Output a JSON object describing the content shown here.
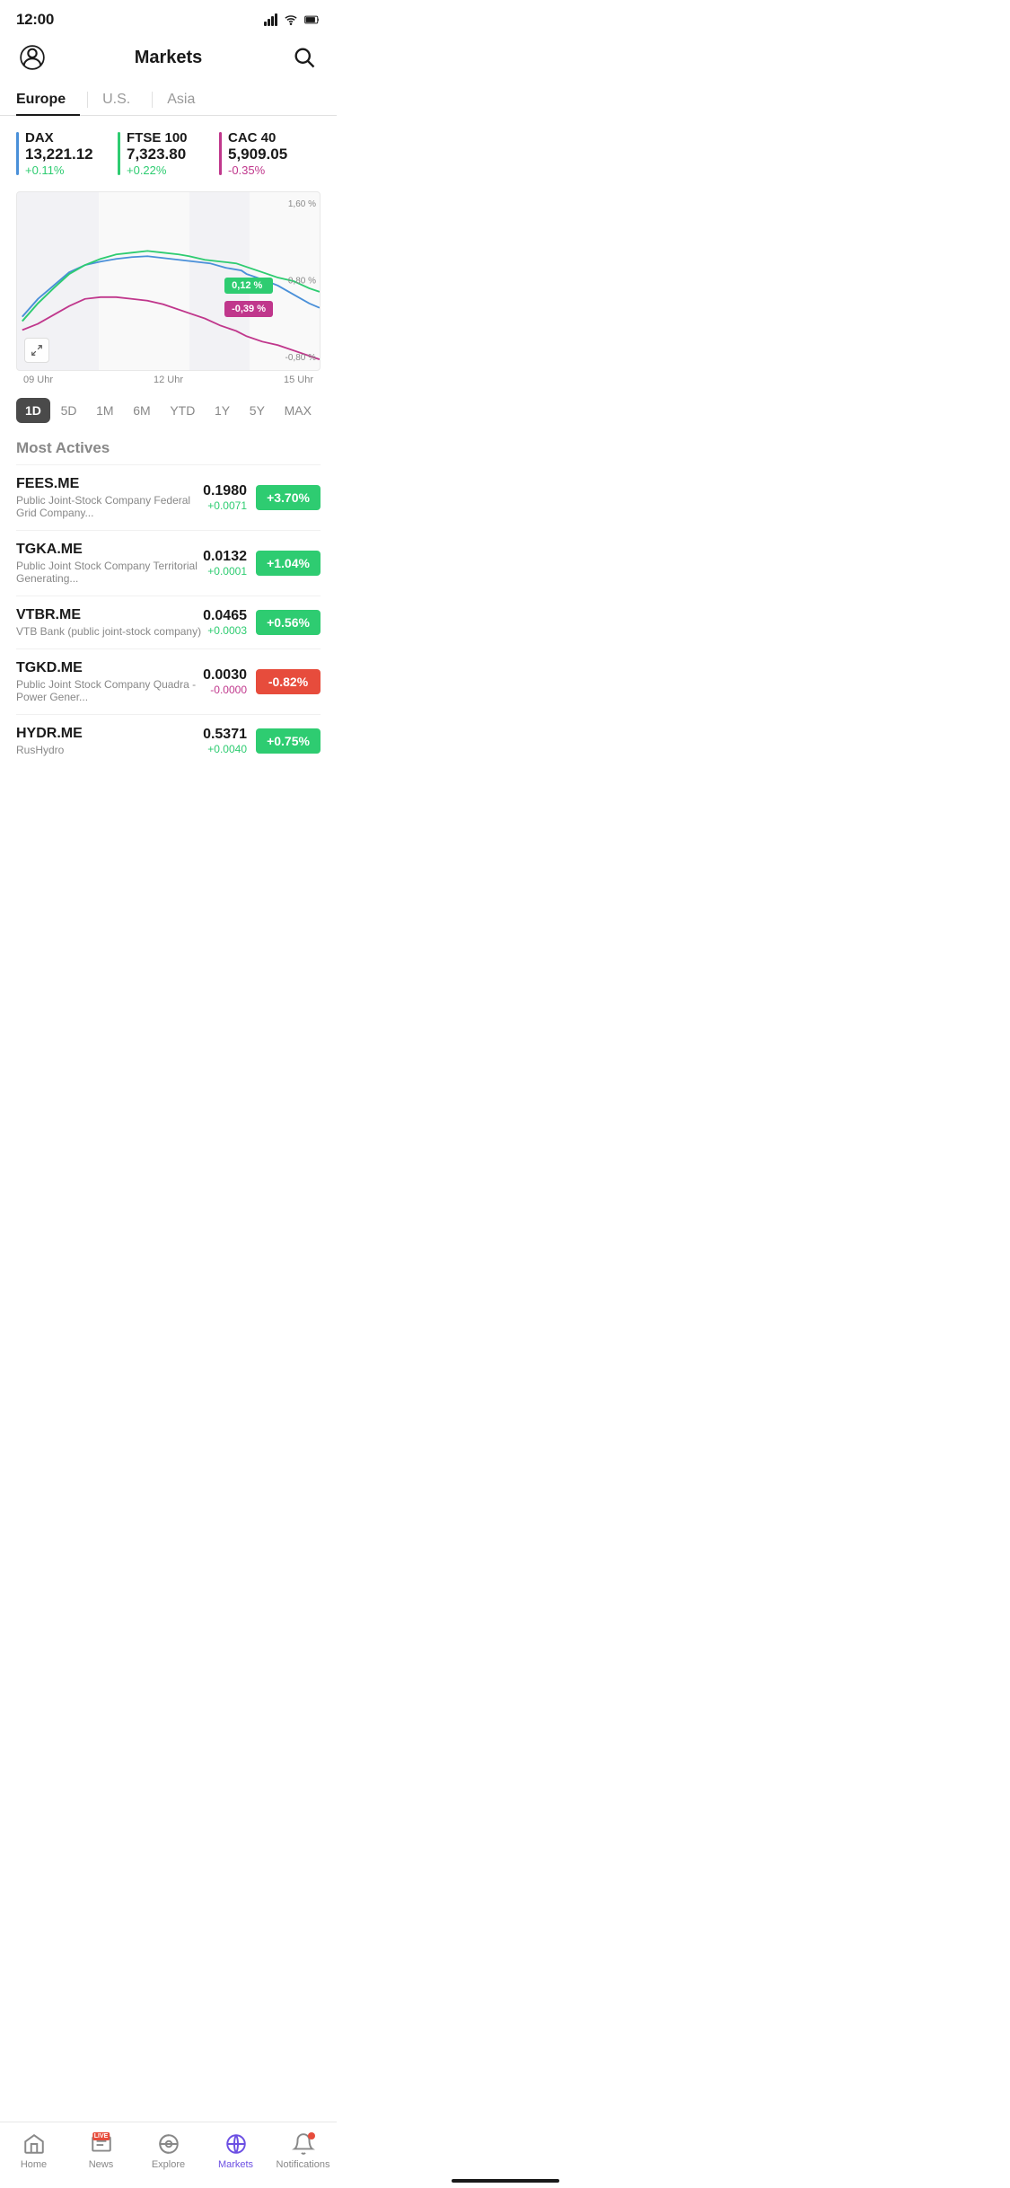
{
  "statusBar": {
    "time": "12:00"
  },
  "header": {
    "title": "Markets"
  },
  "regionTabs": [
    {
      "label": "Europe",
      "active": true
    },
    {
      "label": "U.S.",
      "active": false
    },
    {
      "label": "Asia",
      "active": false
    }
  ],
  "indices": [
    {
      "id": "dax",
      "name": "DAX",
      "value": "13,221.12",
      "change": "+0.11%",
      "positive": true,
      "color": "#4a90d9"
    },
    {
      "id": "ftse",
      "name": "FTSE 100",
      "value": "7,323.80",
      "change": "+0.22%",
      "positive": true,
      "color": "#2ecc71"
    },
    {
      "id": "cac",
      "name": "CAC 40",
      "value": "5,909.05",
      "change": "-0.35%",
      "positive": false,
      "color": "#c0378c"
    }
  ],
  "chart": {
    "yLabels": [
      "1,60 %",
      "0,80 %",
      "-0,80 %"
    ],
    "xLabels": [
      "09 Uhr",
      "12 Uhr",
      "15 Uhr"
    ],
    "badges": [
      {
        "label": "0,12 %",
        "color": "green"
      },
      {
        "label": "-0,39 %",
        "color": "purple"
      }
    ],
    "expandLabel": "↗"
  },
  "timeRange": {
    "options": [
      "1D",
      "5D",
      "1M",
      "6M",
      "YTD",
      "1Y",
      "5Y",
      "MAX"
    ],
    "active": "1D"
  },
  "mostActives": {
    "title": "Most Actives",
    "stocks": [
      {
        "ticker": "FEES.ME",
        "name": "Public Joint-Stock Company Federal Grid Company...",
        "price": "0.1980",
        "changePct": "+3.70%",
        "changeAbs": "+0.0071",
        "positive": true
      },
      {
        "ticker": "TGKA.ME",
        "name": "Public Joint Stock Company Territorial Generating...",
        "price": "0.0132",
        "changePct": "+1.04%",
        "changeAbs": "+0.0001",
        "positive": true
      },
      {
        "ticker": "VTBR.ME",
        "name": "VTB Bank (public joint-stock company)",
        "price": "0.0465",
        "changePct": "+0.56%",
        "changeAbs": "+0.0003",
        "positive": true
      },
      {
        "ticker": "TGKD.ME",
        "name": "Public Joint Stock Company Quadra - Power Gener...",
        "price": "0.0030",
        "changePct": "-0.82%",
        "changeAbs": "-0.0000",
        "positive": false
      },
      {
        "ticker": "HYDR.ME",
        "name": "RusHydro",
        "price": "0.5371",
        "changePct": "+0.75%",
        "changeAbs": "+0.0040",
        "positive": true
      }
    ]
  },
  "bottomNav": [
    {
      "id": "home",
      "label": "Home",
      "active": false
    },
    {
      "id": "news",
      "label": "News",
      "active": false,
      "live": true
    },
    {
      "id": "explore",
      "label": "Explore",
      "active": false
    },
    {
      "id": "markets",
      "label": "Markets",
      "active": true
    },
    {
      "id": "notifications",
      "label": "Notifications",
      "active": false,
      "badge": true
    }
  ]
}
